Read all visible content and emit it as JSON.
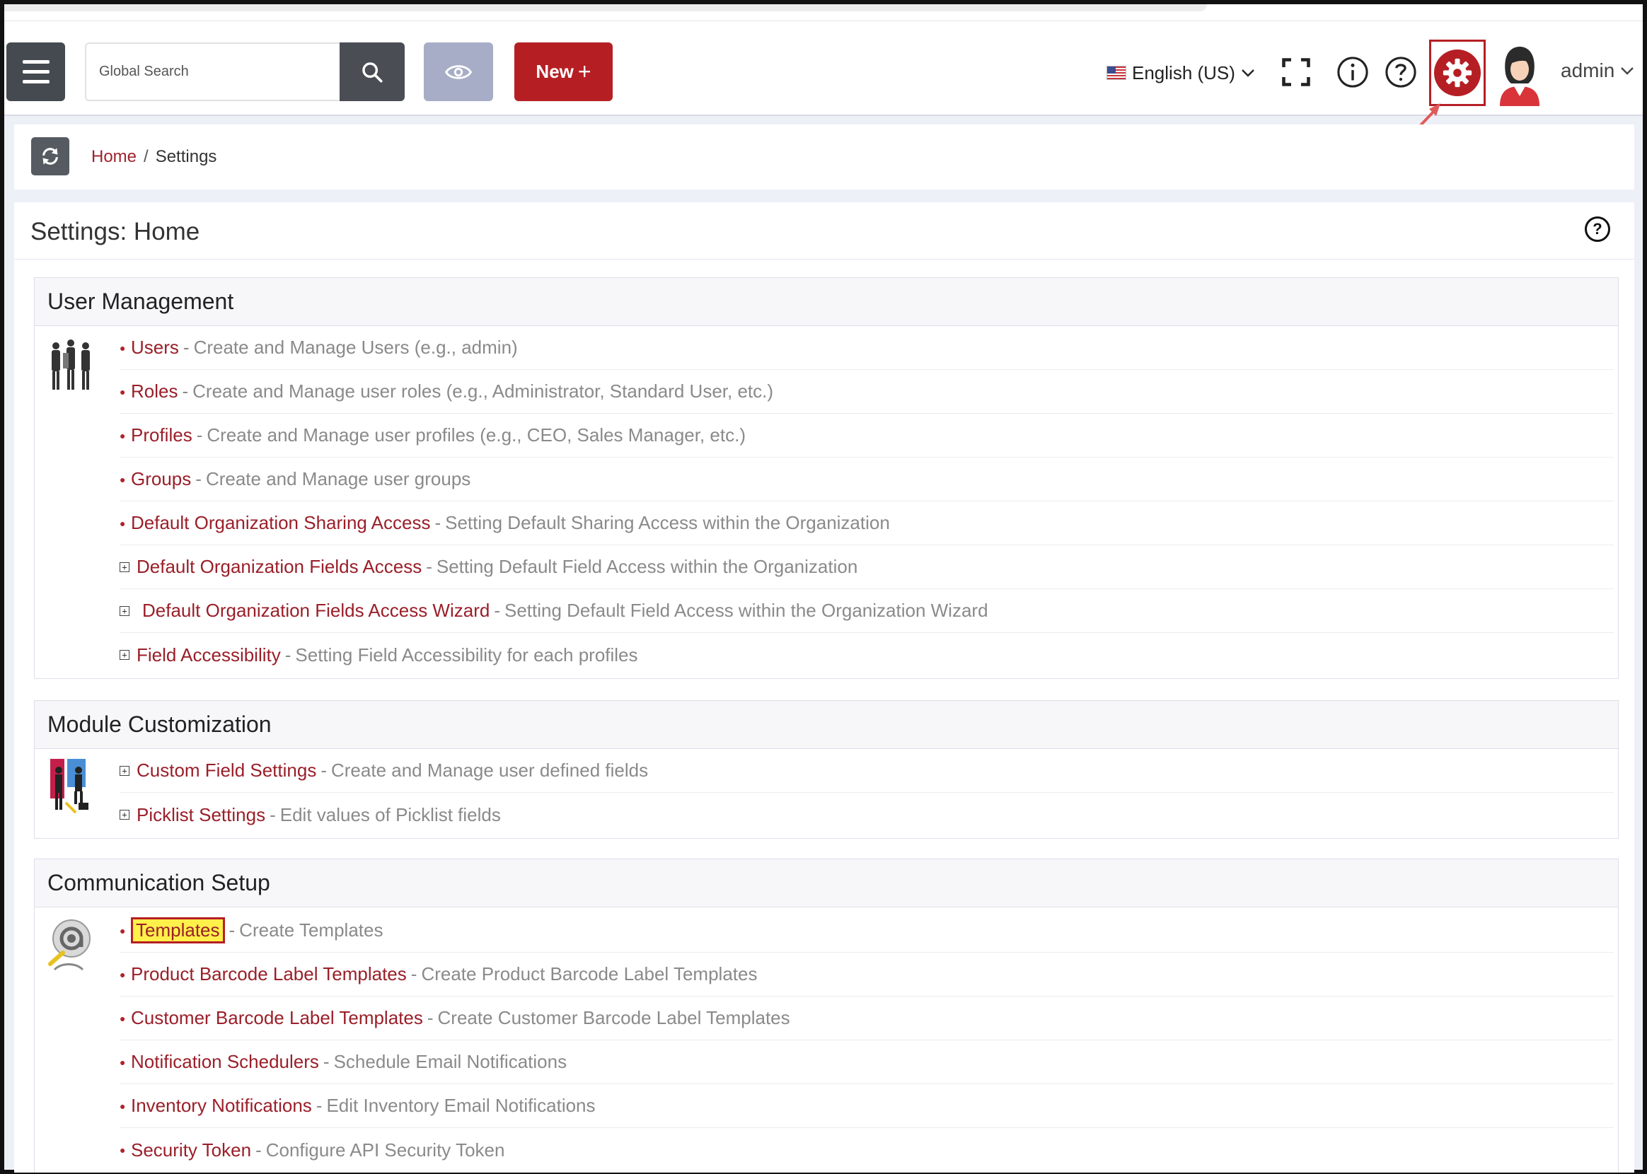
{
  "header": {
    "search_placeholder": "Global Search",
    "new_button_label": "New",
    "new_button_icon": "+",
    "language": "English (US)",
    "user_name": "admin"
  },
  "breadcrumb": {
    "home": "Home",
    "separator": "/",
    "current": "Settings"
  },
  "page": {
    "title": "Settings: Home"
  },
  "sections": [
    {
      "title": "User Management",
      "items": [
        {
          "name": "Users",
          "desc": "Create and Manage Users (e.g., admin)"
        },
        {
          "name": "Roles",
          "desc": "Create and Manage user roles (e.g., Administrator, Standard User, etc.)"
        },
        {
          "name": "Profiles",
          "desc": "Create and Manage user profiles (e.g., CEO, Sales Manager, etc.)"
        },
        {
          "name": "Groups",
          "desc": "Create and Manage user groups"
        },
        {
          "name": "Default Organization Sharing Access",
          "desc": "Setting Default Sharing Access within the Organization"
        },
        {
          "name": "Default Organization Fields Access",
          "desc": "Setting Default Field Access within the Organization"
        },
        {
          "name": "Default Organization Fields Access Wizard",
          "desc": "Setting Default Field Access within the Organization Wizard"
        },
        {
          "name": "Field Accessibility",
          "desc": "Setting Field Accessibility for each profiles"
        }
      ]
    },
    {
      "title": "Module Customization",
      "items": [
        {
          "name": "Custom Field Settings",
          "desc": "Create and Manage user defined fields"
        },
        {
          "name": "Picklist Settings",
          "desc": "Edit values of Picklist fields"
        }
      ]
    },
    {
      "title": "Communication Setup",
      "items": [
        {
          "name": "Templates",
          "desc": "Create Templates"
        },
        {
          "name": "Product Barcode Label Templates",
          "desc": "Create Product Barcode Label Templates"
        },
        {
          "name": "Customer Barcode Label Templates",
          "desc": "Create Customer Barcode Label Templates"
        },
        {
          "name": "Notification Schedulers",
          "desc": "Schedule Email Notifications"
        },
        {
          "name": "Inventory Notifications",
          "desc": "Edit Inventory Email Notifications"
        },
        {
          "name": "Security Token",
          "desc": "Configure API Security Token"
        }
      ]
    }
  ],
  "colors": {
    "accent": "#b51f24",
    "link": "#9a1f29",
    "highlight": "#fff04a"
  },
  "icons": {
    "menu": "hamburger-icon",
    "search": "search-icon",
    "eye": "eye-icon",
    "fullscreen": "fullscreen-icon",
    "info": "info-icon",
    "help": "help-icon",
    "settings": "gear-icon",
    "refresh": "refresh-icon"
  }
}
